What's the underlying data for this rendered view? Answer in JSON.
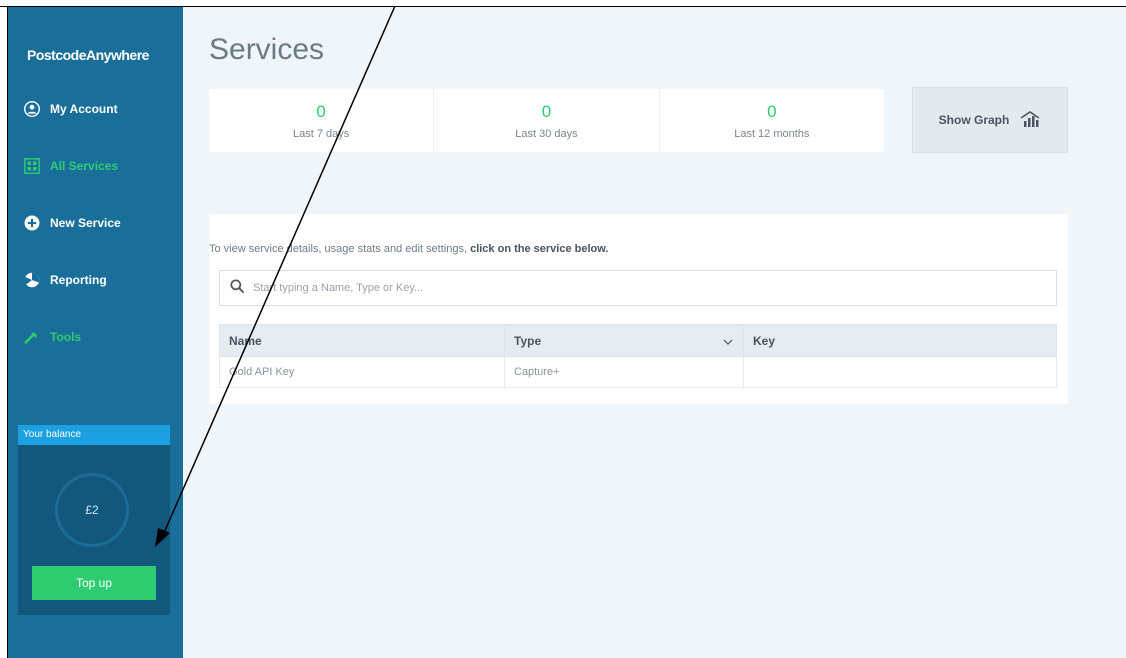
{
  "app": {
    "logo": "PostcodeAnywhere"
  },
  "sidebar": {
    "items": [
      {
        "label": "My Account",
        "icon": "user-circle-icon"
      },
      {
        "label": "All Services",
        "icon": "grid-icon"
      },
      {
        "label": "New Service",
        "icon": "plus-circle-icon"
      },
      {
        "label": "Reporting",
        "icon": "pie-chart-icon"
      },
      {
        "label": "Tools",
        "icon": "wrench-icon"
      }
    ],
    "balance": {
      "header": "Your balance",
      "amount": "£2",
      "topup_label": "Top up"
    }
  },
  "main": {
    "title": "Services",
    "stats": [
      {
        "value": "0",
        "label": "Last 7 days"
      },
      {
        "value": "0",
        "label": "Last 30 days"
      },
      {
        "value": "0",
        "label": "Last 12 months"
      }
    ],
    "graph_button": "Show Graph",
    "instruction_text": "To view service details, usage stats and edit settings, ",
    "instruction_bold": "click on the service below.",
    "search": {
      "placeholder": "Start typing a Name, Type or Key..."
    },
    "table": {
      "headers": [
        "Name",
        "Type",
        "Key"
      ],
      "rows": [
        {
          "name": "Gold API Key",
          "type": "Capture+",
          "key": ""
        }
      ]
    }
  },
  "colors": {
    "sidebar": "#1a6f9a",
    "accent_green": "#2ecc71",
    "balance_header": "#1ba1e2",
    "background": "#f0f5f9"
  }
}
